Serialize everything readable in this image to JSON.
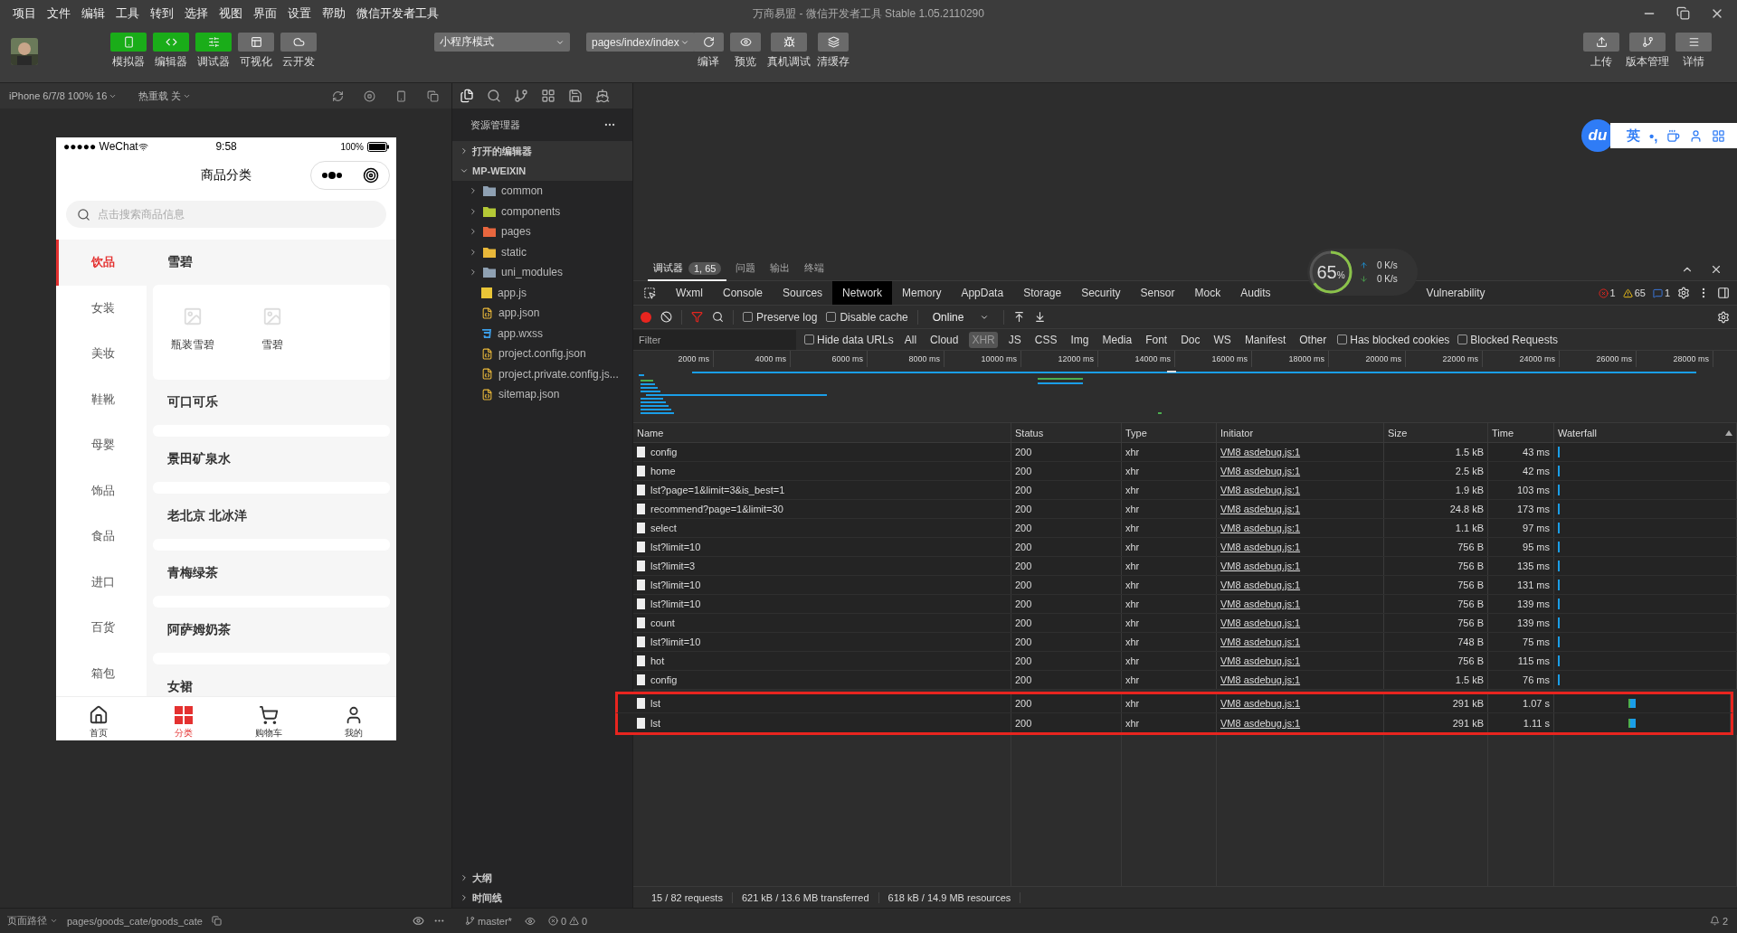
{
  "menu": [
    "项目",
    "文件",
    "编辑",
    "工具",
    "转到",
    "选择",
    "视图",
    "界面",
    "设置",
    "帮助",
    "微信开发者工具"
  ],
  "window": {
    "title": "万商易盟 - 微信开发者工具 Stable 1.05.2110290"
  },
  "toolbar": {
    "left": [
      {
        "label": "模拟器",
        "kind": "phone",
        "selected": true
      },
      {
        "label": "编辑器",
        "kind": "code",
        "selected": true
      },
      {
        "label": "调试器",
        "kind": "debug",
        "selected": true
      },
      {
        "label": "可视化",
        "kind": "layout",
        "selected": false
      },
      {
        "label": "云开发",
        "kind": "cloud",
        "selected": false
      }
    ],
    "mode": "小程序模式",
    "page": "pages/index/index",
    "center": [
      {
        "label": "编译",
        "kind": "refresh"
      },
      {
        "label": "预览",
        "kind": "eye"
      },
      {
        "label": "真机调试",
        "kind": "bug"
      },
      {
        "label": "清缓存",
        "kind": "layers"
      }
    ],
    "right": [
      {
        "label": "上传",
        "kind": "upload"
      },
      {
        "label": "版本管理",
        "kind": "branch"
      },
      {
        "label": "详情",
        "kind": "menu"
      }
    ]
  },
  "simulator": {
    "device": "iPhone 6/7/8 100% 16",
    "hot_reload": "热重载 关"
  },
  "phone": {
    "carrier": "●●●●● WeChat",
    "time": "9:58",
    "battery": "100%",
    "title": "商品分类",
    "search_placeholder": "点击搜索商品信息",
    "categories": [
      {
        "label": "饮品",
        "selected": true
      },
      {
        "label": "女装",
        "selected": false
      },
      {
        "label": "美妆",
        "selected": false
      },
      {
        "label": "鞋靴",
        "selected": false
      },
      {
        "label": "母婴",
        "selected": false
      },
      {
        "label": "饰品",
        "selected": false
      },
      {
        "label": "食品",
        "selected": false
      },
      {
        "label": "进口",
        "selected": false
      },
      {
        "label": "百货",
        "selected": false
      },
      {
        "label": "箱包",
        "selected": false
      }
    ],
    "sections": [
      {
        "title": "雪碧",
        "items": [
          "瓶装雪碧",
          "雪碧"
        ]
      },
      {
        "title": "可口可乐"
      },
      {
        "title": "景田矿泉水"
      },
      {
        "title": "老北京 北冰洋"
      },
      {
        "title": "青梅绿茶"
      },
      {
        "title": "阿萨姆奶茶"
      },
      {
        "title": "女裙"
      }
    ],
    "tabbar": [
      {
        "label": "首页",
        "kind": "home",
        "selected": false
      },
      {
        "label": "分类",
        "kind": "grid",
        "selected": true
      },
      {
        "label": "购物车",
        "kind": "cart",
        "selected": false
      },
      {
        "label": "我的",
        "kind": "user",
        "selected": false
      }
    ]
  },
  "explorer": {
    "title": "资源管理器",
    "open_editors": "打开的编辑器",
    "project": "MP-WEIXIN",
    "items": [
      {
        "name": "common",
        "kind": "folder",
        "color": "#8fa1b3"
      },
      {
        "name": "components",
        "kind": "folder",
        "color": "#b4c936"
      },
      {
        "name": "pages",
        "kind": "folder",
        "color": "#e8663e"
      },
      {
        "name": "static",
        "kind": "folder",
        "color": "#e9b83a"
      },
      {
        "name": "uni_modules",
        "kind": "folder",
        "color": "#8fa1b3"
      },
      {
        "name": "app.js",
        "kind": "js"
      },
      {
        "name": "app.json",
        "kind": "json"
      },
      {
        "name": "app.wxss",
        "kind": "css"
      },
      {
        "name": "project.config.json",
        "kind": "json"
      },
      {
        "name": "project.private.config.js...",
        "kind": "json"
      },
      {
        "name": "sitemap.json",
        "kind": "json"
      }
    ],
    "outline": "大纲",
    "timeline": "时间线"
  },
  "ime": {
    "logo": "du",
    "lang": "英",
    "punct": "•,"
  },
  "devtools": {
    "panel_tabs": [
      {
        "label": "调试器",
        "badge": "1, 65",
        "selected": true
      },
      {
        "label": "问题",
        "selected": false
      },
      {
        "label": "输出",
        "selected": false
      },
      {
        "label": "终端",
        "selected": false
      }
    ],
    "perf": {
      "percent": "65",
      "unit": "%",
      "level": 0.65,
      "up": "0",
      "up_unit": "K/s",
      "down": "0",
      "down_unit": "K/s"
    },
    "tabs": [
      {
        "label": "Wxml",
        "selected": false
      },
      {
        "label": "Console",
        "selected": false
      },
      {
        "label": "Sources",
        "selected": false
      },
      {
        "label": "Network",
        "selected": true
      },
      {
        "label": "Memory",
        "selected": false
      },
      {
        "label": "AppData",
        "selected": false
      },
      {
        "label": "Storage",
        "selected": false
      },
      {
        "label": "Security",
        "selected": false
      },
      {
        "label": "Sensor",
        "selected": false
      },
      {
        "label": "Mock",
        "selected": false
      },
      {
        "label": "Audits",
        "selected": false
      },
      {
        "label": "Vulnerability",
        "selected": false
      }
    ],
    "counts": {
      "errors": "1",
      "warnings": "65",
      "info": "1"
    },
    "preserve_log": {
      "label": "Preserve log",
      "checked": false
    },
    "disable_cache": {
      "label": "Disable cache",
      "checked": false
    },
    "throttle": "Online",
    "filter_placeholder": "Filter",
    "hide_data_urls": {
      "label": "Hide data URLs",
      "checked": false
    },
    "types": [
      {
        "label": "All",
        "selected": false
      },
      {
        "label": "Cloud",
        "selected": false
      },
      {
        "label": "XHR",
        "selected": true
      },
      {
        "label": "JS",
        "selected": false
      },
      {
        "label": "CSS",
        "selected": false
      },
      {
        "label": "Img",
        "selected": false
      },
      {
        "label": "Media",
        "selected": false
      },
      {
        "label": "Font",
        "selected": false
      },
      {
        "label": "Doc",
        "selected": false
      },
      {
        "label": "WS",
        "selected": false
      },
      {
        "label": "Manifest",
        "selected": false
      },
      {
        "label": "Other",
        "selected": false
      }
    ],
    "blocked_cookies": {
      "label": "Has blocked cookies",
      "checked": false
    },
    "blocked_requests": {
      "label": "Blocked Requests",
      "checked": false
    },
    "overview_ticks": [
      "2000 ms",
      "4000 ms",
      "6000 ms",
      "8000 ms",
      "10000 ms",
      "12000 ms",
      "14000 ms",
      "16000 ms",
      "18000 ms",
      "20000 ms",
      "22000 ms",
      "24000 ms",
      "26000 ms",
      "28000 ms"
    ],
    "columns": [
      "Name",
      "Status",
      "Type",
      "Initiator",
      "Size",
      "Time",
      "Waterfall"
    ],
    "rows": [
      {
        "name": "config",
        "status": "200",
        "type": "xhr",
        "initiator": "VM8 asdebug.js:1",
        "size": "1.5 kB",
        "time": "43 ms",
        "kind": "early",
        "highlighted": false
      },
      {
        "name": "home",
        "status": "200",
        "type": "xhr",
        "initiator": "VM8 asdebug.js:1",
        "size": "2.5 kB",
        "time": "42 ms",
        "kind": "early",
        "highlighted": false
      },
      {
        "name": "lst?page=1&limit=3&is_best=1",
        "status": "200",
        "type": "xhr",
        "initiator": "VM8 asdebug.js:1",
        "size": "1.9 kB",
        "time": "103 ms",
        "kind": "early",
        "highlighted": false
      },
      {
        "name": "recommend?page=1&limit=30",
        "status": "200",
        "type": "xhr",
        "initiator": "VM8 asdebug.js:1",
        "size": "24.8 kB",
        "time": "173 ms",
        "kind": "early",
        "highlighted": false
      },
      {
        "name": "select",
        "status": "200",
        "type": "xhr",
        "initiator": "VM8 asdebug.js:1",
        "size": "1.1 kB",
        "time": "97 ms",
        "kind": "early",
        "highlighted": false
      },
      {
        "name": "lst?limit=10",
        "status": "200",
        "type": "xhr",
        "initiator": "VM8 asdebug.js:1",
        "size": "756 B",
        "time": "95 ms",
        "kind": "early",
        "highlighted": false
      },
      {
        "name": "lst?limit=3",
        "status": "200",
        "type": "xhr",
        "initiator": "VM8 asdebug.js:1",
        "size": "756 B",
        "time": "135 ms",
        "kind": "early",
        "highlighted": false
      },
      {
        "name": "lst?limit=10",
        "status": "200",
        "type": "xhr",
        "initiator": "VM8 asdebug.js:1",
        "size": "756 B",
        "time": "131 ms",
        "kind": "early",
        "highlighted": false
      },
      {
        "name": "lst?limit=10",
        "status": "200",
        "type": "xhr",
        "initiator": "VM8 asdebug.js:1",
        "size": "756 B",
        "time": "139 ms",
        "kind": "early",
        "highlighted": false
      },
      {
        "name": "count",
        "status": "200",
        "type": "xhr",
        "initiator": "VM8 asdebug.js:1",
        "size": "756 B",
        "time": "139 ms",
        "kind": "early",
        "highlighted": false
      },
      {
        "name": "lst?limit=10",
        "status": "200",
        "type": "xhr",
        "initiator": "VM8 asdebug.js:1",
        "size": "748 B",
        "time": "75 ms",
        "kind": "early",
        "highlighted": false
      },
      {
        "name": "hot",
        "status": "200",
        "type": "xhr",
        "initiator": "VM8 asdebug.js:1",
        "size": "756 B",
        "time": "115 ms",
        "kind": "early",
        "highlighted": false
      },
      {
        "name": "config",
        "status": "200",
        "type": "xhr",
        "initiator": "VM8 asdebug.js:1",
        "size": "1.5 kB",
        "time": "76 ms",
        "kind": "early",
        "highlighted": false
      },
      {
        "name": "lst",
        "status": "200",
        "type": "xhr",
        "initiator": "VM8 asdebug.js:1",
        "size": "291 kB",
        "time": "1.07 s",
        "kind": "late",
        "highlighted": true
      },
      {
        "name": "lst",
        "status": "200",
        "type": "xhr",
        "initiator": "VM8 asdebug.js:1",
        "size": "291 kB",
        "time": "1.11 s",
        "kind": "late",
        "highlighted": true
      }
    ],
    "summary": [
      "15 / 82 requests",
      "621 kB / 13.6 MB transferred",
      "618 kB / 14.9 MB resources"
    ]
  },
  "status_bar": {
    "path_label": "页面路径",
    "path": "pages/goods_cate/goods_cate",
    "branch": "master*",
    "errors": "0",
    "warnings": "0",
    "notifications": "2"
  }
}
